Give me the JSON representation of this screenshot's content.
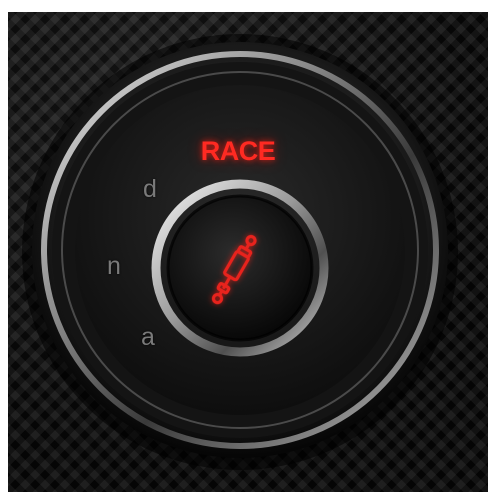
{
  "mode_display": {
    "active_mode": "RACE",
    "color": "#ff2a22"
  },
  "selector": {
    "positions": [
      "d",
      "n",
      "a"
    ]
  },
  "center_button": {
    "icon": "shock-absorber-icon",
    "color": "#e8231d"
  }
}
